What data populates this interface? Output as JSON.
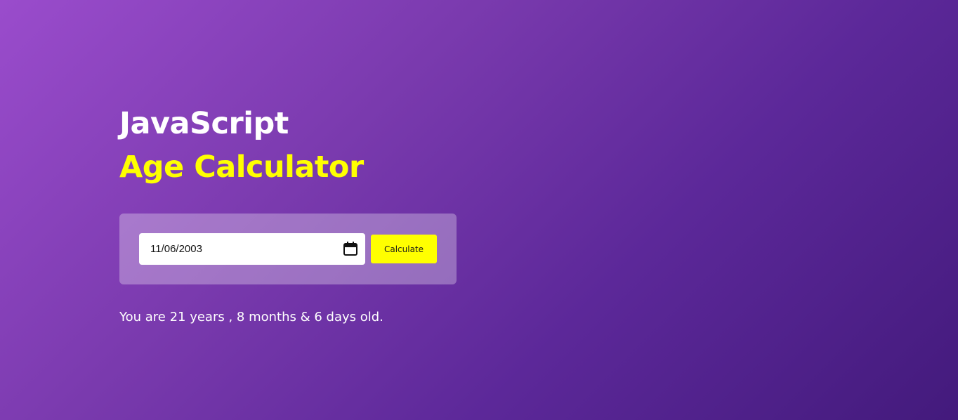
{
  "header": {
    "title_line1": "JavaScript",
    "title_line2": "Age Calculator"
  },
  "form": {
    "date_value": "11/06/2003",
    "date_icon": "calendar-icon",
    "calculate_label": "Calculate"
  },
  "result": {
    "text": "You are 21 years , 8 months & 6 days old."
  },
  "colors": {
    "accent": "#ffff00",
    "gradient_start": "#9a4ccc",
    "gradient_end": "#431a7c",
    "text": "#ffffff"
  }
}
